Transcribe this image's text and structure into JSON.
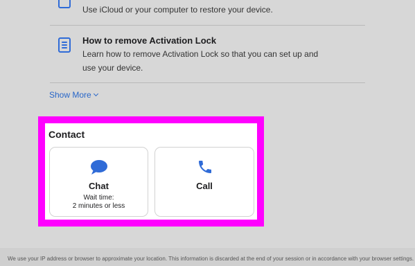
{
  "articles": [
    {
      "title": "",
      "description": "Use iCloud or your computer to restore your device."
    },
    {
      "title": "How to remove Activation Lock",
      "description": "Learn how to remove Activation Lock so that you can set up and use your device."
    }
  ],
  "show_more": {
    "label": "Show More"
  },
  "contact": {
    "heading": "Contact",
    "options": [
      {
        "label": "Chat",
        "icon": "chat-bubble-icon",
        "wait_label": "Wait time:",
        "wait_value": "2 minutes or less"
      },
      {
        "label": "Call",
        "icon": "phone-icon"
      }
    ]
  },
  "footer": {
    "text": "We use your IP address or browser to approximate your location. This information is discarded at the end of your session or in accordance with your browser settings."
  },
  "colors": {
    "accent": "#2f6bd7",
    "highlight": "#ff00ff",
    "page_background": "#d7d7d7"
  }
}
